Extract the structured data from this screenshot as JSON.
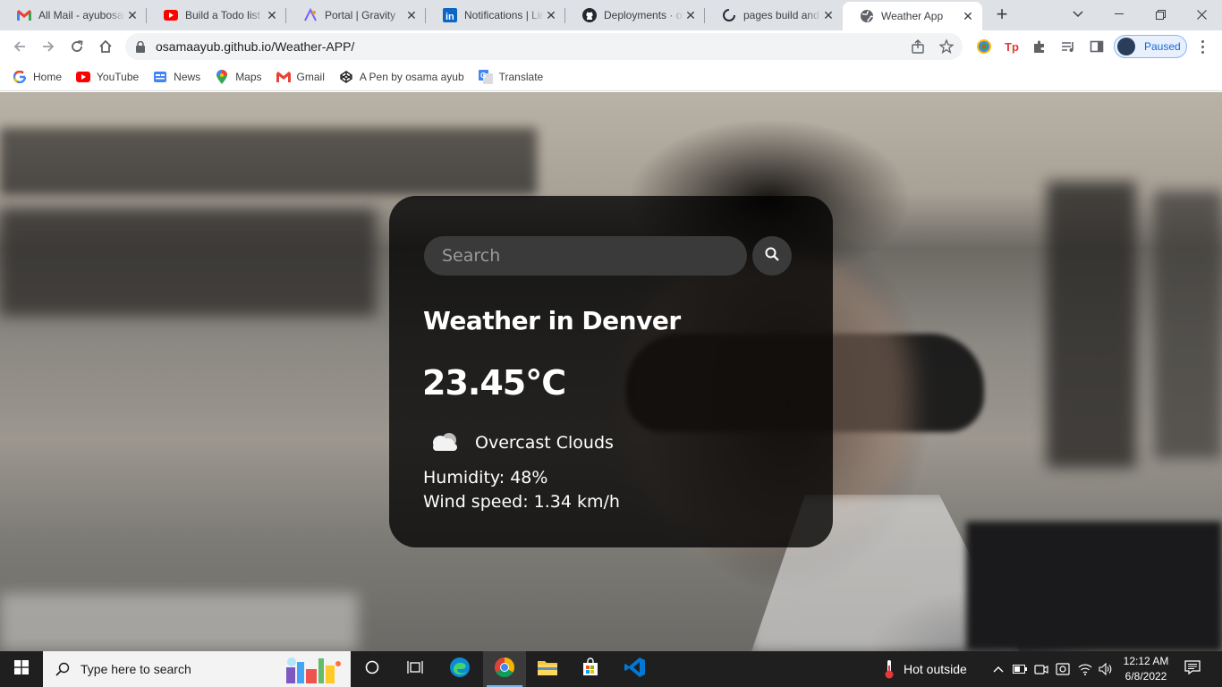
{
  "browser": {
    "tabs": [
      {
        "title": "All Mail - ayubosama",
        "icon": "gmail-icon"
      },
      {
        "title": "Build a Todo list app",
        "icon": "youtube-icon"
      },
      {
        "title": "Portal | Gravity",
        "icon": "gravity-icon"
      },
      {
        "title": "Notifications | LinkedIn",
        "icon": "linkedin-icon"
      },
      {
        "title": "Deployments · osama",
        "icon": "github-icon"
      },
      {
        "title": "pages build and deploy",
        "icon": "github-actions-icon"
      },
      {
        "title": "Weather App",
        "icon": "globe-icon",
        "active": true
      }
    ],
    "url": "osamaayub.github.io/Weather-APP/",
    "profile_status": "Paused",
    "bookmarks": [
      {
        "label": "Home",
        "icon": "google-icon"
      },
      {
        "label": "YouTube",
        "icon": "youtube-icon"
      },
      {
        "label": "News",
        "icon": "google-news-icon"
      },
      {
        "label": "Maps",
        "icon": "google-maps-icon"
      },
      {
        "label": "Gmail",
        "icon": "gmail-icon"
      },
      {
        "label": "A Pen by osama ayub",
        "icon": "codepen-icon"
      },
      {
        "label": "Translate",
        "icon": "google-translate-icon"
      }
    ]
  },
  "weather": {
    "search_placeholder": "Search",
    "city_heading": "Weather in Denver",
    "temperature": "23.45°C",
    "description": "Overcast Clouds",
    "humidity": "Humidity: 48%",
    "wind": "Wind speed: 1.34 km/h"
  },
  "taskbar": {
    "search_placeholder": "Type here to search",
    "weather_widget": "Hot outside",
    "time": "12:12 AM",
    "date": "6/8/2022"
  },
  "colors": {
    "card_bg": "rgba(0,0,0,0.78)",
    "chrome_tabstrip": "#dee1e6",
    "taskbar_bg": "#1f1f1f",
    "accent_blue": "#1a73e8"
  }
}
